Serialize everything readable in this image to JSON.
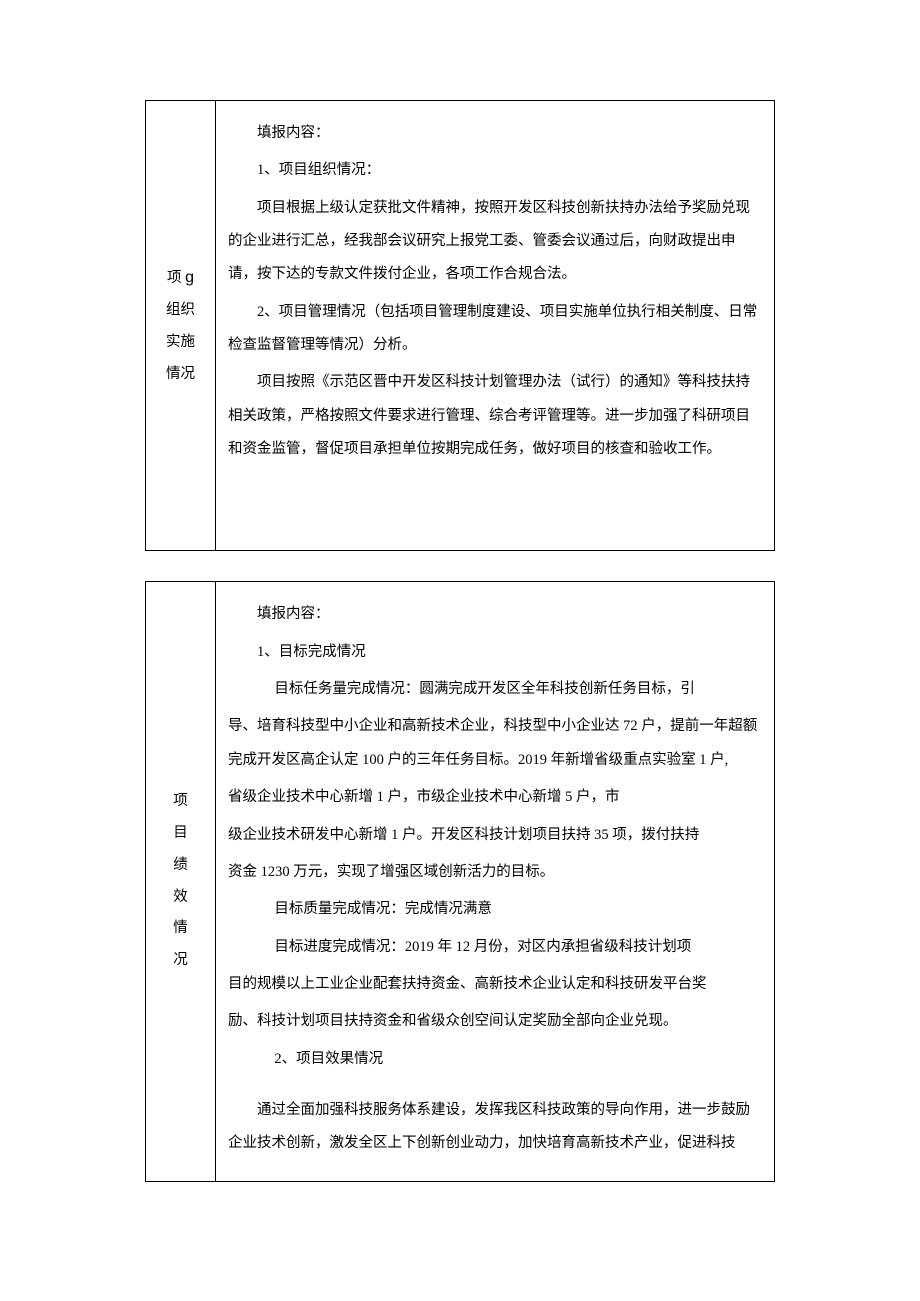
{
  "section1": {
    "label_char1": "项",
    "label_char1b": "g",
    "label_char2": "组织",
    "label_char3": "实施",
    "label_char4": "情况",
    "heading": "填报内容：",
    "p1_title": "1、项目组织情况：",
    "p1_body": "项目根据上级认定获批文件精神，按照开发区科技创新扶持办法给予奖励兑现的企业进行汇总，经我部会议研究上报党工委、管委会议通过后，向财政提出申请，按下达的专款文件拨付企业，各项工作合规合法。",
    "p2_title": "2、项目管理情况（包括项目管理制度建设、项目实施单位执行相关制度、日常检查监督管理等情况）分析。",
    "p2_body": "项目按照《示范区晋中开发区科技计划管理办法（试行）的通知》等科技扶持相关政策，严格按照文件要求进行管理、综合考评管理等。进一步加强了科研项目和资金监管，督促项目承担单位按期完成任务，做好项目的核查和验收工作。"
  },
  "section2": {
    "label_char1": "项",
    "label_char1b": "目",
    "label_char2": "绩",
    "label_char3": "效",
    "label_char4": "情",
    "label_char5": "况",
    "heading": "填报内容：",
    "p1_title": "1、目标完成情况",
    "p1a": "目标任务量完成情况：圆满完成开发区全年科技创新任务目标，引",
    "p1b": "导、培育科技型中小企业和高新技术企业，科技型中小企业达 72 户，提前一年超额完成开发区高企认定 100 户的三年任务目标。2019 年新增省级重点实验室 1 户,",
    "p1c": "省级企业技术中心新增 1 户，市级企业技术中心新增 5 户，市",
    "p1d": "级企业技术研发中心新增 1 户。开发区科技计划项目扶持 35 项，拨付扶持",
    "p1e": "资金 1230 万元，实现了增强区域创新活力的目标。",
    "p2": "目标质量完成情况：完成情况满意",
    "p3a": "目标进度完成情况：2019 年 12 月份，对区内承担省级科技计划项",
    "p3b": "目的规模以上工业企业配套扶持资金、高新技术企业认定和科技研发平台奖",
    "p3c": "励、科技计划项目扶持资金和省级众创空间认定奖励全部向企业兑现。",
    "p4_title": "2、项目效果情况",
    "p5": "通过全面加强科技服务体系建设，发挥我区科技政策的导向作用，进一步鼓励企业技术创新，激发全区上下创新创业动力，加快培育高新技术产业，促进科技"
  }
}
